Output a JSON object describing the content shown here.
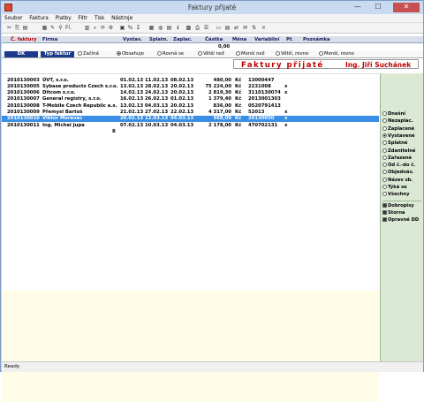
{
  "window": {
    "title": "Faktury přijaté",
    "minimize": "—",
    "maximize": "☐",
    "close": "✕"
  },
  "menu": [
    {
      "label": "Soubor"
    },
    {
      "label": "Faktura"
    },
    {
      "label": "Platby"
    },
    {
      "label": "Filtr"
    },
    {
      "label": "Tisk"
    },
    {
      "label": "Nástroje"
    }
  ],
  "toolbar": [
    {
      "icon": "cut-icon",
      "glyph": "✂"
    },
    {
      "icon": "copy-icon",
      "glyph": "⎘"
    },
    {
      "icon": "paste-icon",
      "glyph": "▤"
    },
    {
      "icon": "new-icon",
      "glyph": "▦"
    },
    {
      "icon": "edit-icon",
      "glyph": "✎"
    },
    {
      "icon": "filter-icon",
      "glyph": "⚲"
    },
    {
      "icon": "filter-text-icon",
      "glyph": "Fl."
    },
    {
      "icon": "grid-icon",
      "glyph": "▥"
    },
    {
      "icon": "find-icon",
      "glyph": "⌕"
    },
    {
      "icon": "refresh-icon",
      "glyph": "⟳"
    },
    {
      "icon": "settings-icon",
      "glyph": "⚙"
    },
    {
      "icon": "copy-doc-icon",
      "glyph": "▣"
    },
    {
      "icon": "percent-icon",
      "glyph": "%"
    },
    {
      "icon": "sum-icon",
      "glyph": "Σ"
    },
    {
      "icon": "calendar-icon",
      "glyph": "▦"
    },
    {
      "icon": "globe-icon",
      "glyph": "◍"
    },
    {
      "icon": "export-icon",
      "glyph": "▤"
    },
    {
      "icon": "info-icon",
      "glyph": "ℹ"
    },
    {
      "icon": "bank-icon",
      "glyph": "▩"
    },
    {
      "icon": "print-icon",
      "glyph": "⎙"
    },
    {
      "icon": "list-icon",
      "glyph": "☰"
    },
    {
      "icon": "chart-icon",
      "glyph": "▭"
    },
    {
      "icon": "view-icon",
      "glyph": "▤"
    },
    {
      "icon": "pay-icon",
      "glyph": "⇄"
    },
    {
      "icon": "mail-icon",
      "glyph": "✉"
    },
    {
      "icon": "sort-icon",
      "glyph": "⇅"
    },
    {
      "icon": "close-icon",
      "glyph": "×"
    }
  ],
  "columns": {
    "c_faktury": "Č. faktury",
    "firma": "Firma",
    "vystav": "Vystav.",
    "splatn": "Splatn.",
    "zaplac": "Zaplac.",
    "castka": "Částka",
    "mena": "Měna",
    "variabilni": "Variabilní",
    "pr": "Př.",
    "poznamka": "Poznámka"
  },
  "sum_total": "0,00",
  "filter": {
    "dk_label": "DK",
    "typ_label": "Typ faktur",
    "options": [
      {
        "label": "Začíná",
        "checked": false
      },
      {
        "label": "Obsahuje",
        "checked": true
      },
      {
        "label": "Rovná se",
        "checked": false
      },
      {
        "label": "Větší než",
        "checked": false
      },
      {
        "label": "Menší než",
        "checked": false
      },
      {
        "label": "Větší, rovno",
        "checked": false
      },
      {
        "label": "Menší, rovno",
        "checked": false
      }
    ]
  },
  "banner": {
    "title": "Faktury přijaté",
    "user": "Ing. Jiří Suchánek"
  },
  "rows": [
    {
      "cislo": "2010130003",
      "firma": "ÚVT, s.r.o.",
      "vystav": "01.02.13",
      "splatn": "11.02.13",
      "zaplac": "08.02.13",
      "castka": "480,00",
      "mena": "Kč",
      "variabilni": "13000447",
      "pr": ""
    },
    {
      "cislo": "2010130005",
      "firma": "Sybase products Czech s.r.o.",
      "vystav": "13.02.13",
      "splatn": "28.02.13",
      "zaplac": "20.02.13",
      "castka": "75 224,00",
      "mena": "Kč",
      "variabilni": "2231008",
      "pr": "x"
    },
    {
      "cislo": "2010130006",
      "firma": "Ditcom s.r.o.",
      "vystav": "14.02.13",
      "splatn": "24.02.13",
      "zaplac": "20.02.13",
      "castka": "2 819,30",
      "mena": "Kč",
      "variabilni": "3110130074",
      "pr": "x"
    },
    {
      "cislo": "2010130007",
      "firma": "General registry, s.r.o.",
      "vystav": "16.02.13",
      "splatn": "26.02.13",
      "zaplac": "01.02.13",
      "castka": "1 379,40",
      "mena": "Kč",
      "variabilni": "2013001303",
      "pr": ""
    },
    {
      "cislo": "2010130008",
      "firma": "T-Mobile Czech Republic a.s.",
      "vystav": "13.02.13",
      "splatn": "04.03.13",
      "zaplac": "20.02.13",
      "castka": "836,00",
      "mena": "Kč",
      "variabilni": "0520791413",
      "pr": ""
    },
    {
      "cislo": "2010130009",
      "firma": "Přemysl Bartoš",
      "vystav": "21.02.13",
      "splatn": "27.02.13",
      "zaplac": "22.02.13",
      "castka": "4 317,00",
      "mena": "Kč",
      "variabilni": "52013",
      "pr": "x"
    },
    {
      "cislo": "2010130010",
      "firma": "Viktor Moravec",
      "vystav": "26.02.13",
      "splatn": "13.03.13",
      "zaplac": "04.03.13",
      "castka": "968,00",
      "mena": "Kč",
      "variabilni": "20130050",
      "pr": "x"
    },
    {
      "cislo": "2010130011",
      "firma": "Ing. Michal Jupa",
      "vystav": "07.02.13",
      "splatn": "10.03.13",
      "zaplac": "04.03.13",
      "castka": "2 178,00",
      "mena": "Kč",
      "variabilni": "470702131",
      "pr": "x"
    }
  ],
  "selected_row": 6,
  "row_count": "8",
  "right_panel": {
    "radios": [
      {
        "label": "Dnešní",
        "checked": false
      },
      {
        "label": "Nezaplac.",
        "checked": false
      },
      {
        "label": "Zaplacené",
        "checked": false
      },
      {
        "label": "Vystavené",
        "checked": true
      },
      {
        "label": "Splatné",
        "checked": false
      },
      {
        "label": "Zdanitelné",
        "checked": false
      },
      {
        "label": "Zařazené",
        "checked": false
      },
      {
        "label": "Od č.-do č.",
        "checked": false
      },
      {
        "label": "Objednáv.",
        "checked": false
      },
      {
        "label": "Název zb.",
        "checked": false
      },
      {
        "label": "Týká se",
        "checked": false
      },
      {
        "label": "Všechny",
        "checked": false
      }
    ],
    "checks": [
      {
        "label": "Dobropisy",
        "checked": true
      },
      {
        "label": "Storna",
        "checked": true
      },
      {
        "label": "Opravné DD",
        "checked": true
      }
    ]
  },
  "status": "Ready",
  "colors": {
    "selected_row": "#3a8ee6",
    "banner_red": "#c00000",
    "filter_button": "#1c3a8c",
    "right_panel": "#dbe9d4",
    "lower_area": "#fffde7"
  }
}
